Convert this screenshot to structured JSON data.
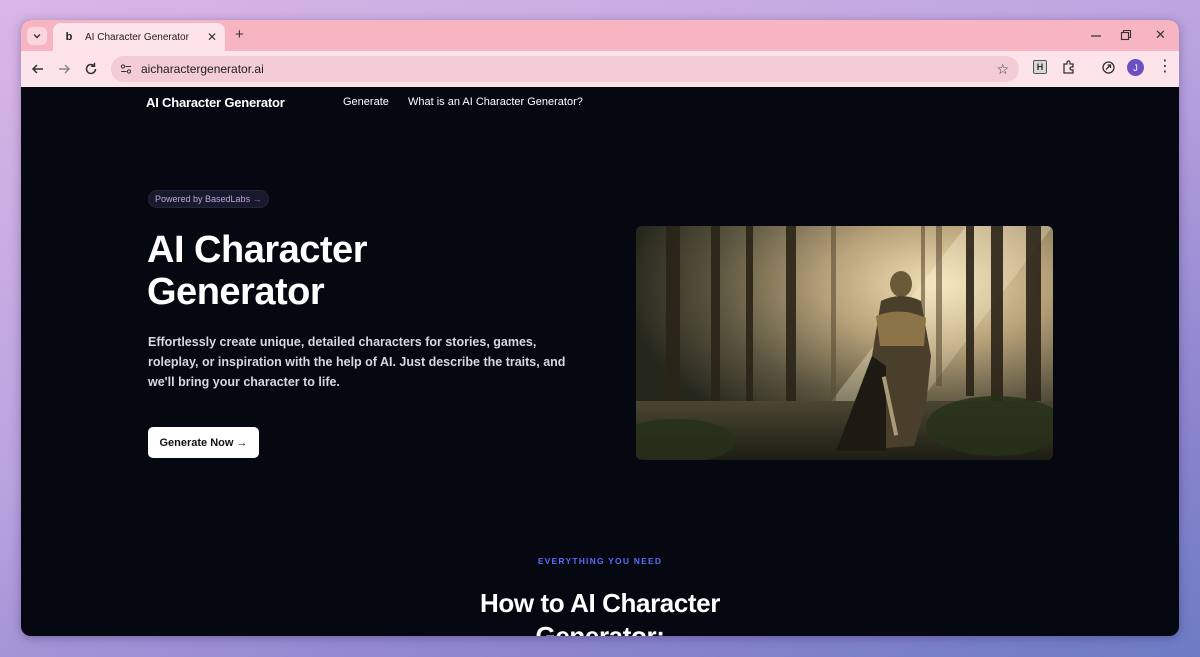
{
  "browser": {
    "tab_title": "AI Character Generator",
    "url": "aicharactergenerator.ai",
    "new_tab_glyph": "+",
    "close_glyph": "✕",
    "extension_letter": "H",
    "profile_initial": "J",
    "icons": [
      "tab-search-icon",
      "favicon-icon",
      "back-icon",
      "forward-icon",
      "reload-icon",
      "site-info-icon",
      "bookmark-star-icon",
      "extensions-icon",
      "copilot-icon",
      "menu-icon",
      "minimize-icon",
      "restore-icon"
    ]
  },
  "site": {
    "brand": "AI Character Generator",
    "nav": {
      "generate": "Generate",
      "what_is": "What is an AI Character Generator?"
    },
    "hero": {
      "badge_text": "Powered by BasedLabs",
      "badge_arrow": "→",
      "title": "AI Character Generator",
      "description": "Effortlessly create unique, detailed characters for stories, games, roleplay, or inspiration with the help of AI. Just describe the traits, and we'll bring your character to life.",
      "cta_label": "Generate Now →",
      "image": "armored-knight-in-misty-forest"
    },
    "section": {
      "eyebrow": "EVERYTHING YOU NEED",
      "title": "How to AI Character Generator:"
    }
  },
  "colors": {
    "tabbar": "#f7b5c2",
    "toolbar": "#fde4ea",
    "page_bg": "#050810",
    "eyebrow": "#5b6cf6",
    "badge_text": "#c2a0dc"
  }
}
